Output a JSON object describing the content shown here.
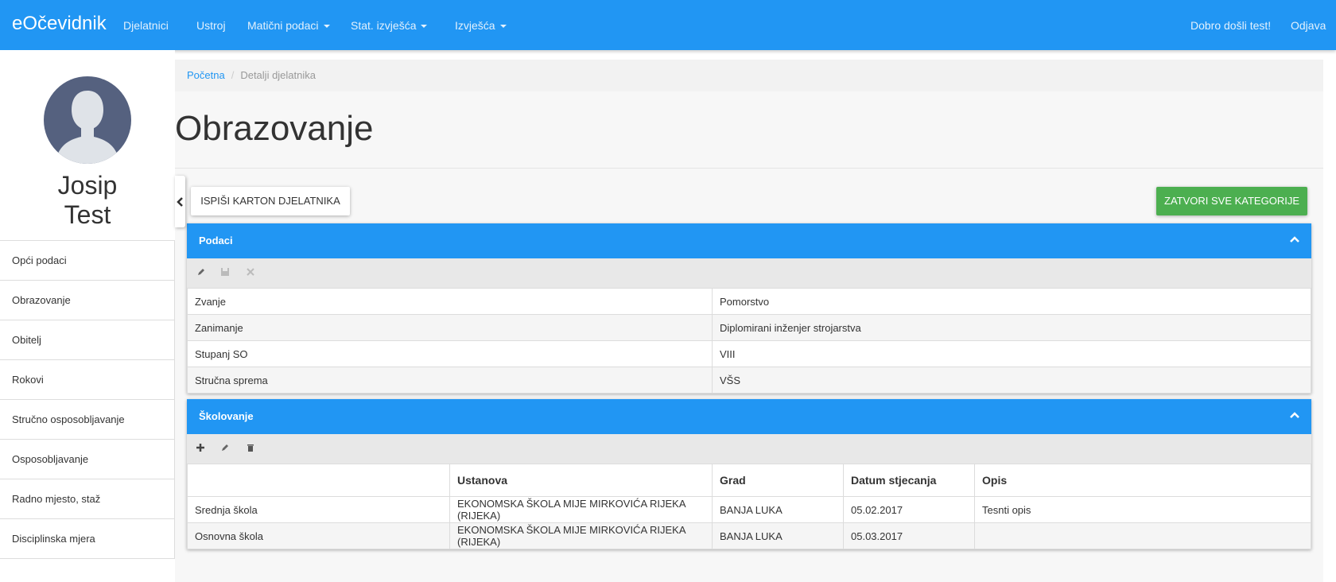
{
  "navbar": {
    "brand": "eOčevidnik",
    "items": [
      "Djelatnici",
      "Ustroj",
      "Matični podaci",
      "Stat. izvješća",
      "Izvješća"
    ],
    "welcome": "Dobro došli test!",
    "logout": "Odjava"
  },
  "sidebar": {
    "first_name": "Josip",
    "last_name": "Test",
    "items": [
      "Opći podaci",
      "Obrazovanje",
      "Obitelj",
      "Rokovi",
      "Stručno osposobljavanje",
      "Osposobljavanje",
      "Radno mjesto, staž",
      "Disciplinska mjera"
    ]
  },
  "breadcrumb": {
    "home": "Početna",
    "current": "Detalji djelatnika"
  },
  "page_title": "Obrazovanje",
  "buttons": {
    "print": "ISPIŠI KARTON DJELATNIKA",
    "close_all": "ZATVORI SVE KATEGORIJE"
  },
  "podaci": {
    "title": "Podaci",
    "rows": [
      {
        "label": "Zvanje",
        "value": "Pomorstvo"
      },
      {
        "label": "Zanimanje",
        "value": "Diplomirani inženjer strojarstva"
      },
      {
        "label": "Stupanj SO",
        "value": "VIII"
      },
      {
        "label": "Stručna sprema",
        "value": "VŠS"
      }
    ]
  },
  "skolovanje": {
    "title": "Školovanje",
    "columns": [
      "",
      "Ustanova",
      "Grad",
      "Datum stjecanja",
      "Opis"
    ],
    "rows": [
      [
        "Srednja škola",
        "EKONOMSKA ŠKOLA MIJE MIRKOVIĆA RIJEKA (RIJEKA)",
        "BANJA LUKA",
        "05.02.2017",
        "Tesnti opis"
      ],
      [
        "Osnovna škola",
        "EKONOMSKA ŠKOLA MIJE MIRKOVIĆA RIJEKA (RIJEKA)",
        "BANJA LUKA",
        "05.03.2017",
        ""
      ]
    ]
  },
  "colors": {
    "primary": "#2196f3",
    "success": "#4caf50",
    "avatar": "#55617f"
  },
  "icons": [
    "caret-down-icon",
    "user-silhouette-icon",
    "chevron-left-icon",
    "chevron-up-icon",
    "pencil-icon",
    "save-icon",
    "close-icon",
    "plus-icon",
    "trash-icon"
  ]
}
